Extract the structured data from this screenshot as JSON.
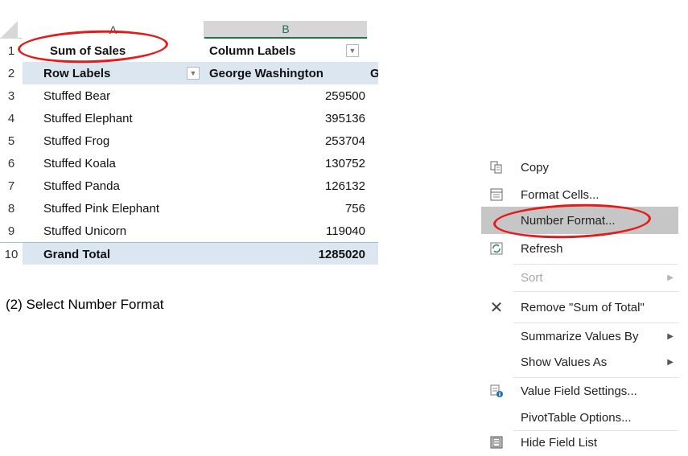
{
  "sheet": {
    "columns": [
      "A",
      "B"
    ],
    "rows": [
      {
        "num": "1",
        "a": "Sum of Sales",
        "b": "Column Labels",
        "c": ""
      },
      {
        "num": "2",
        "a": "Row Labels",
        "b": "George Washington",
        "c": "G"
      },
      {
        "num": "3",
        "a": "Stuffed Bear",
        "b": "259500"
      },
      {
        "num": "4",
        "a": "Stuffed Elephant",
        "b": "395136"
      },
      {
        "num": "5",
        "a": "Stuffed Frog",
        "b": "253704"
      },
      {
        "num": "6",
        "a": "Stuffed Koala",
        "b": "130752"
      },
      {
        "num": "7",
        "a": "Stuffed Panda",
        "b": "126132"
      },
      {
        "num": "8",
        "a": "Stuffed Pink Elephant",
        "b": "756"
      },
      {
        "num": "9",
        "a": "Stuffed Unicorn",
        "b": "119040"
      },
      {
        "num": "10",
        "a": "Grand Total",
        "b": "1285020"
      }
    ]
  },
  "caption": "(2)   Select Number Format",
  "menu": {
    "items": [
      {
        "label": "Copy",
        "icon": "copy-icon"
      },
      {
        "label": "Format Cells...",
        "icon": "format-cells-icon"
      },
      {
        "label": "Number Format...",
        "icon": "",
        "highlighted": true
      },
      {
        "label": "Refresh",
        "icon": "refresh-icon"
      },
      {
        "label": "Sort",
        "icon": "",
        "disabled": true,
        "submenu": true
      },
      {
        "label": "Remove \"Sum of Total\"",
        "icon": "remove-icon"
      },
      {
        "label": "Summarize Values By",
        "icon": "",
        "submenu": true
      },
      {
        "label": "Show Values As",
        "icon": "",
        "submenu": true
      },
      {
        "label": "Value Field Settings...",
        "icon": "value-field-settings-icon"
      },
      {
        "label": "PivotTable Options...",
        "icon": ""
      },
      {
        "label": "Hide Field List",
        "icon": "field-list-icon"
      }
    ]
  },
  "colors": {
    "highlight": "#c6c6c6",
    "annotation": "#e31b1b",
    "pivot_header": "#dce6f1",
    "selected_column": "#217346"
  }
}
